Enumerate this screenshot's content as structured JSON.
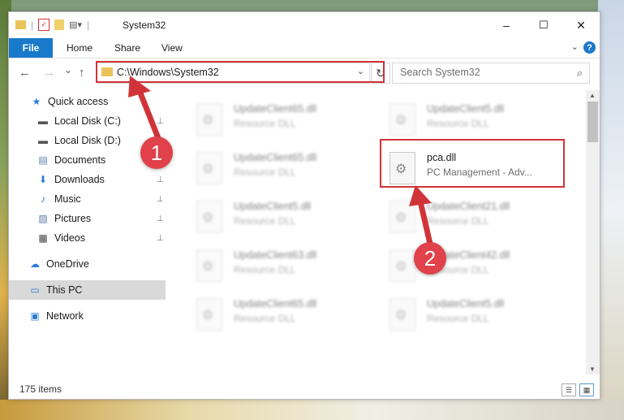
{
  "window": {
    "title": "System32",
    "controls": {
      "minimize": "–",
      "maximize": "☐",
      "close": "✕"
    }
  },
  "ribbon": {
    "tabs": [
      "File",
      "Home",
      "Share",
      "View"
    ],
    "help": "?"
  },
  "navigation": {
    "back": "←",
    "forward": "→",
    "recent": "⌄",
    "up": "↑",
    "address": "C:\\Windows\\System32",
    "search_placeholder": "Search System32",
    "refresh": "↻"
  },
  "sidebar": {
    "items": [
      {
        "label": "Quick access",
        "icon": "star-icon",
        "glyph": "★",
        "color": "#2b7cd3"
      },
      {
        "label": "Local Disk (C:)",
        "icon": "drive-icon",
        "glyph": "▬",
        "color": "#555555",
        "pinned": true
      },
      {
        "label": "Local Disk (D:)",
        "icon": "drive-icon",
        "glyph": "▬",
        "color": "#555555"
      },
      {
        "label": "Documents",
        "icon": "documents-icon",
        "glyph": "▤",
        "color": "#5a7aa8"
      },
      {
        "label": "Downloads",
        "icon": "download-icon",
        "glyph": "⬇",
        "color": "#2b7cd3",
        "pinned": true
      },
      {
        "label": "Music",
        "icon": "music-icon",
        "glyph": "♪",
        "color": "#2b7cd3",
        "pinned": true
      },
      {
        "label": "Pictures",
        "icon": "pictures-icon",
        "glyph": "▨",
        "color": "#5a7aa8",
        "pinned": true
      },
      {
        "label": "Videos",
        "icon": "videos-icon",
        "glyph": "▦",
        "color": "#444444",
        "pinned": true
      },
      {
        "label": "OneDrive",
        "icon": "cloud-icon",
        "glyph": "☁",
        "color": "#2b7cd3"
      },
      {
        "label": "This PC",
        "icon": "computer-icon",
        "glyph": "▭",
        "color": "#2b7cd3"
      },
      {
        "label": "Network",
        "icon": "network-icon",
        "glyph": "▣",
        "color": "#2b7cd3"
      }
    ],
    "pin_glyph": "📌"
  },
  "files": [
    {
      "name": "UpdateClient65.dll",
      "desc": "Resource DLL",
      "blurred": true
    },
    {
      "name": "UpdateClient5.dll",
      "desc": "Resource DLL",
      "blurred": true
    },
    {
      "name": "UpdateClient65.dll",
      "desc": "Resource DLL",
      "blurred": true
    },
    {
      "name": "pca.dll",
      "desc": "PC Management - Adv...",
      "blurred": false
    },
    {
      "name": "UpdateClient5.dll",
      "desc": "Resource DLL",
      "blurred": true
    },
    {
      "name": "UpdateClient21.dll",
      "desc": "Resource DLL",
      "blurred": true
    },
    {
      "name": "UpdateClient63.dll",
      "desc": "Resource DLL",
      "blurred": true
    },
    {
      "name": "UpdateClient42.dll",
      "desc": "Resource DLL",
      "blurred": true
    },
    {
      "name": "UpdateClient65.dll",
      "desc": "Resource DLL",
      "blurred": true
    },
    {
      "name": "UpdateClient5.dll",
      "desc": "Resource DLL",
      "blurred": true
    }
  ],
  "status": {
    "item_count": "175 items"
  },
  "annotations": {
    "step1": "1",
    "step2": "2",
    "color": "#d13438"
  }
}
